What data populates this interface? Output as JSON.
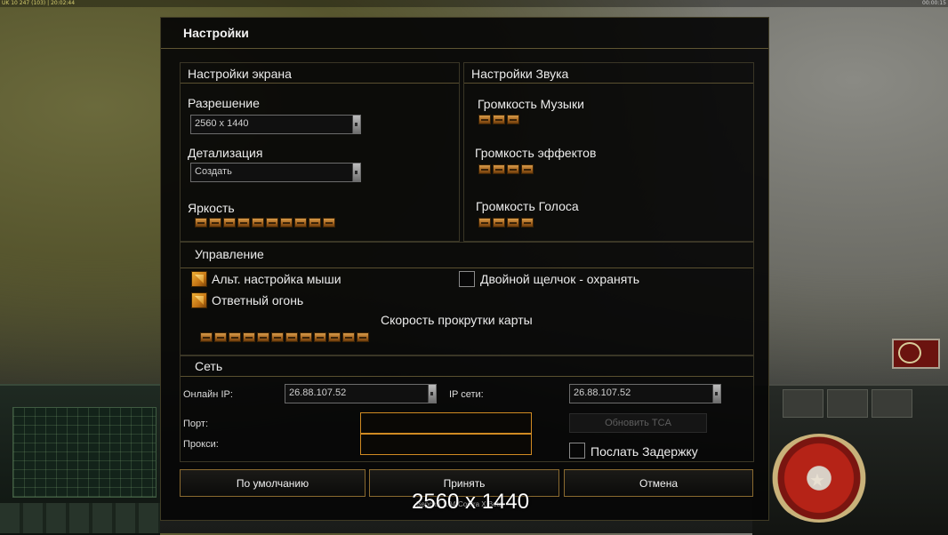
{
  "hud": {
    "top_left": "UK 10 247 (103) | 20:02:44",
    "top_right": "00:00:15"
  },
  "dialog": {
    "title": "Настройки",
    "screen": {
      "title": "Настройки экрана",
      "resolution_label": "Разрешение",
      "resolution_value": "2560 x 1440",
      "detail_label": "Детализация",
      "detail_value": "Создать",
      "brightness_label": "Яркость",
      "brightness_level": 10
    },
    "sound": {
      "title": "Настройки Звука",
      "music_label": "Громкость Музыки",
      "music_level": 3,
      "effects_label": "Громкость эффектов",
      "effects_level": 4,
      "voice_label": "Громкость Голоса",
      "voice_level": 4
    },
    "controls": {
      "title": "Управление",
      "alt_mouse_label": "Альт. настройка мыши",
      "alt_mouse_checked": true,
      "return_fire_label": "Ответный огонь",
      "return_fire_checked": true,
      "double_click_label": "Двойной щелчок - охранять",
      "double_click_checked": false,
      "scroll_speed_label": "Скорость прокрутки карты",
      "scroll_speed_level": 12
    },
    "network": {
      "title": "Сеть",
      "online_ip_label": "Онлайн IP:",
      "online_ip_value": "26.88.107.52",
      "lan_ip_label": "IP сети:",
      "lan_ip_value": "26.88.107.52",
      "port_label": "Порт:",
      "port_value": "",
      "proxy_label": "Прокси:",
      "proxy_value": "",
      "update_tca_label": "Обновить TCA",
      "send_delay_label": "Послать Задержку",
      "send_delay_checked": false
    },
    "buttons": {
      "default": "По умолчанию",
      "accept": "Принять",
      "cancel": "Отмена"
    }
  },
  "overlay": {
    "resolution_text": "2560 x 1440",
    "version_text": "Версия 1.04 Contra X Beta"
  },
  "colors": {
    "accent_orange": "#d08a22",
    "panel_border": "#5a5030",
    "dialog_bg": "#060606"
  }
}
